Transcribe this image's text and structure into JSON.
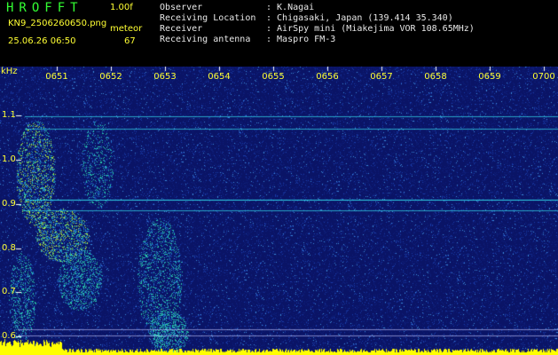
{
  "header": {
    "app_title": "HROFFT",
    "version": "1.00f",
    "filename": "KN9_2506260650.png",
    "datetime": "25.06.26 06:50",
    "meteor_label": "meteor",
    "meteor_count": "67",
    "info": [
      {
        "key": "Observer",
        "value": ": K.Nagai"
      },
      {
        "key": "Receiving Location",
        "value": ": Chigasaki, Japan (139.414 35.340)"
      },
      {
        "key": "Receiver",
        "value": ": AirSpy mini (Miakejima VOR 108.65MHz)"
      },
      {
        "key": "Receiving antenna",
        "value": ": Maspro FM-3"
      }
    ]
  },
  "spectrogram": {
    "freq_unit": "kHz",
    "time_labels": [
      "0651",
      "0652",
      "0653",
      "0654",
      "0655",
      "0656",
      "0657",
      "0658",
      "0659",
      "0700"
    ],
    "freq_labels": [
      "1.1",
      "1.0",
      "0.9",
      "0.8",
      "0.7",
      "0.6"
    ],
    "background_color": "#0a1466",
    "label_color": "#ffff33",
    "tick_color": "#ffffff",
    "signal_line_color": "#33ddee",
    "floor_color": "#ffff00"
  }
}
